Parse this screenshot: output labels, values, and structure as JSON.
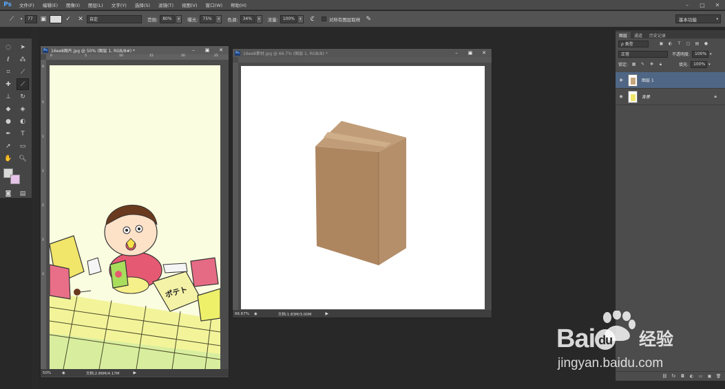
{
  "menubar": {
    "logo": "Ps",
    "items": [
      "文件(F)",
      "编辑(E)",
      "图像(I)",
      "图层(L)",
      "文字(Y)",
      "选择(S)",
      "滤镜(T)",
      "视图(V)",
      "窗口(W)",
      "帮助(H)"
    ],
    "window_controls": [
      "–",
      "□",
      "✕"
    ]
  },
  "options_bar": {
    "brush_size": "77",
    "mode_value": "自定",
    "range_label": "范围:",
    "range_value": "80%",
    "exposure_label": "曝光:",
    "exposure_value": "75%",
    "tone_label": "色调:",
    "tone_value": "34%",
    "flow_label": "流量:",
    "flow_value": "100%",
    "sample_all_label": "对所有图层取样",
    "workspace": "基本功能"
  },
  "doc1": {
    "title": "16ee8图片.jpg @ 50% (图层 1, RGB/8#) *",
    "ruler_h": [
      "0",
      "5",
      "10",
      "15",
      "20",
      "25"
    ],
    "ruler_v": [
      "0",
      "5",
      "1",
      "1",
      "2",
      "2",
      "3"
    ],
    "zoom": "50%",
    "docinfo": "文档:2.86M/4.17M"
  },
  "doc2": {
    "title": "16ee8素材.jpg @ 66.7% (图层 1, RGB/8) *",
    "zoom": "66.67%",
    "docinfo": "文档:1.83M/3.00M"
  },
  "panel": {
    "tabs": [
      "图层",
      "通道",
      "历史记录"
    ],
    "filter_label": "ρ 类型",
    "blend_mode": "正常",
    "opacity_label": "不透明度:",
    "opacity_value": "100%",
    "lock_label": "锁定:",
    "fill_label": "填充:",
    "fill_value": "100%",
    "layers": [
      {
        "name": "图层 1",
        "selected": true
      },
      {
        "name": "背景",
        "selected": false
      }
    ]
  },
  "watermark": {
    "brand": "Bai",
    "du": "du",
    "jingyan": "经验",
    "url": "jingyan.baidu.com"
  },
  "colors": {
    "accent": "#4f6685",
    "fg_swatch": "#d9d9d9",
    "bg_swatch": "#e6c3e8"
  }
}
